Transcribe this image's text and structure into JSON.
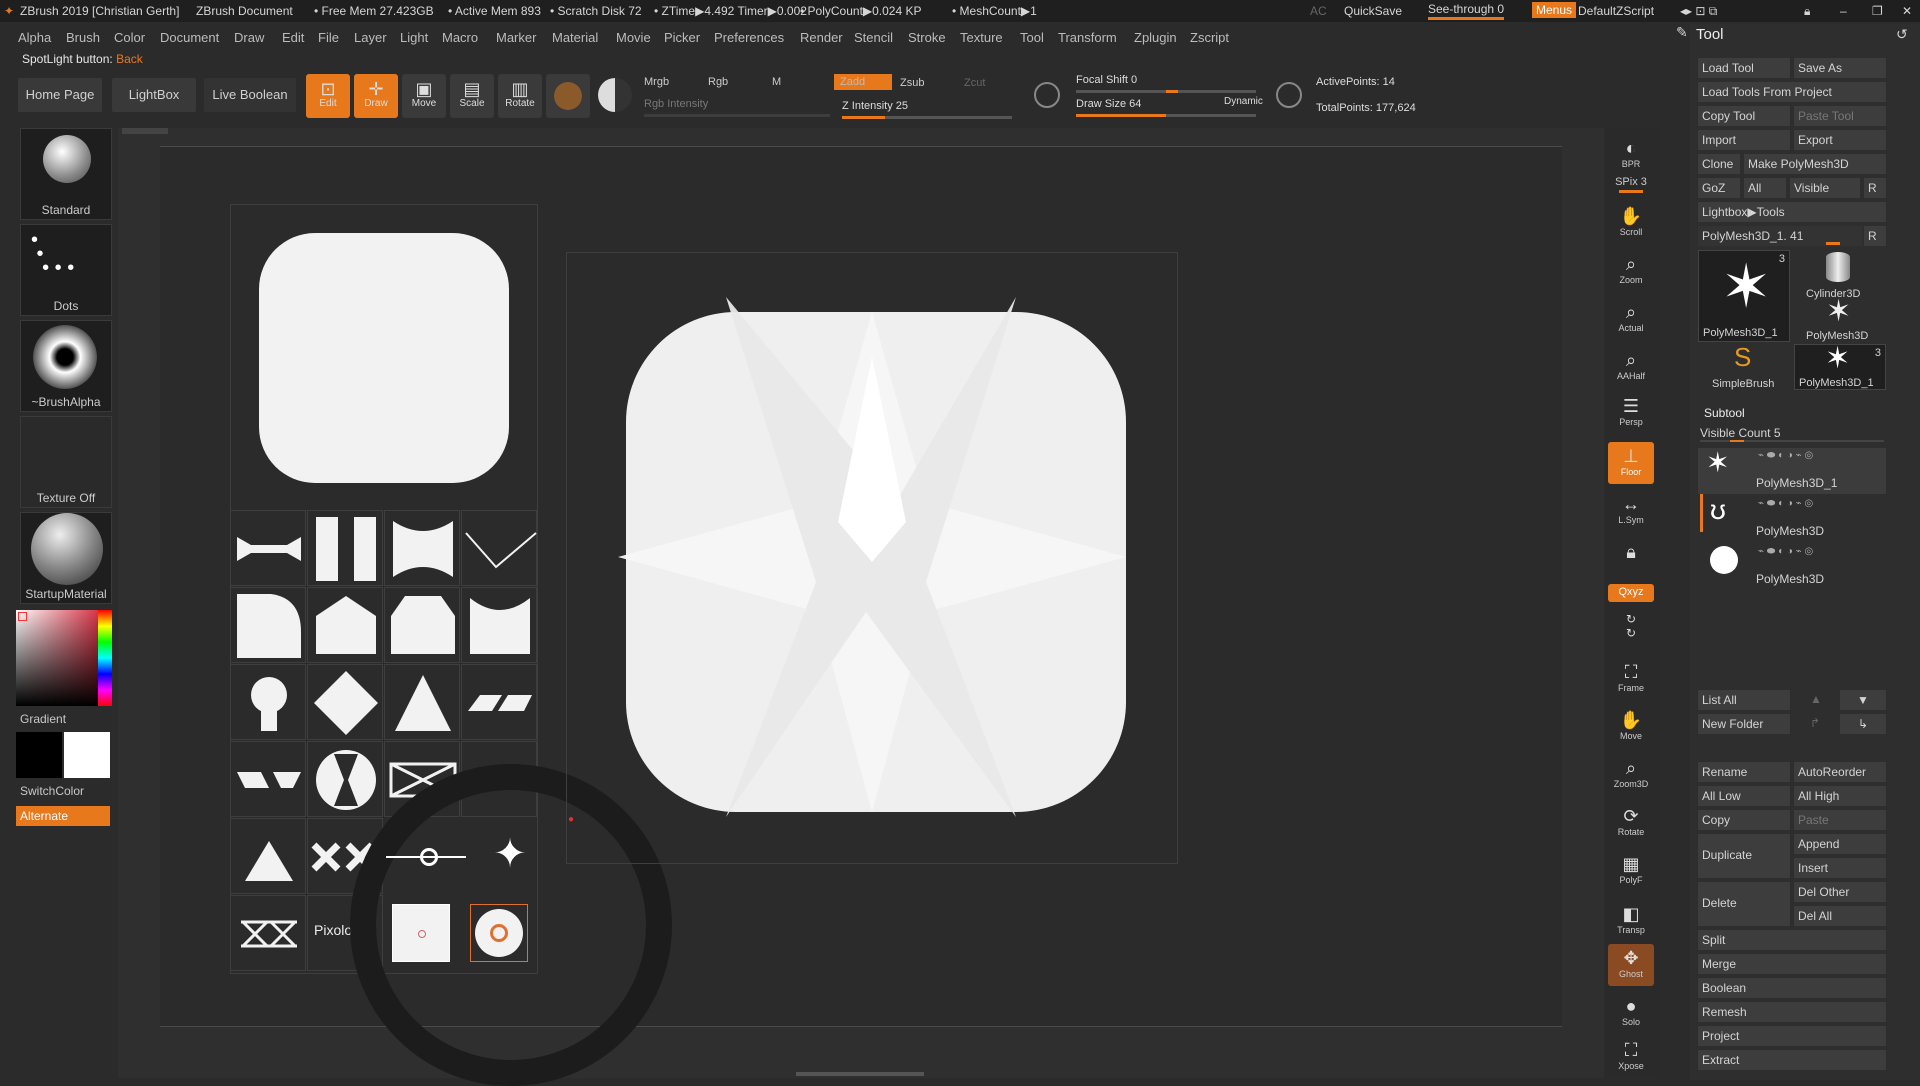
{
  "titlebar": {
    "app": "ZBrush 2019 [Christian Gerth]",
    "document": "ZBrush Document",
    "free_mem": "• Free Mem 27.423GB",
    "active_mem": "• Active Mem 893",
    "scratch": "• Scratch Disk 72",
    "ztime": "• ZTime▶4.492 Timer▶0.002",
    "polycount": "• PolyCount▶0.024 KP",
    "meshcount": "• MeshCount▶1",
    "ac": "AC",
    "quicksave": "QuickSave",
    "seethrough": "See-through  0",
    "menus": "Menus",
    "script": "DefaultZScript"
  },
  "menubar": [
    "Alpha",
    "Brush",
    "Color",
    "Document",
    "Draw",
    "Edit",
    "File",
    "Layer",
    "Light",
    "Macro",
    "Marker",
    "Material",
    "Movie",
    "Picker",
    "Preferences",
    "Render",
    "Stencil",
    "Stroke",
    "Texture",
    "Tool",
    "Transform",
    "Zplugin",
    "Zscript"
  ],
  "spotlight": {
    "label": "SpotLight button:",
    "value": "Back"
  },
  "shelf": {
    "home": "Home Page",
    "lightbox": "LightBox",
    "liveboolean": "Live Boolean",
    "tools": [
      {
        "label": "Edit",
        "icon": "edit-icon",
        "on": true
      },
      {
        "label": "Draw",
        "icon": "draw-icon",
        "on": true
      },
      {
        "label": "Move",
        "icon": "move-icon",
        "on": false
      },
      {
        "label": "Scale",
        "icon": "scale-icon",
        "on": false
      },
      {
        "label": "Rotate",
        "icon": "rotate-icon",
        "on": false
      }
    ],
    "mrgb": "Mrgb",
    "rgb": "Rgb",
    "m": "M",
    "rgb_intensity": "Rgb Intensity",
    "zadd": "Zadd",
    "zsub": "Zsub",
    "zcut": "Zcut",
    "z_intensity": "Z Intensity 25",
    "z_intensity_value": 25,
    "focal_shift": "Focal Shift 0",
    "draw_size": "Draw Size 64",
    "draw_size_value": 64,
    "dynamic": "Dynamic",
    "active_points": "ActivePoints: 14",
    "total_points": "TotalPoints: 177,624"
  },
  "left": {
    "brush": "Standard",
    "stroke": "Dots",
    "alpha": "~BrushAlpha",
    "texture": "Texture Off",
    "material": "StartupMaterial",
    "gradient": "Gradient",
    "switchcolor": "SwitchColor",
    "alternate": "Alternate"
  },
  "spotlight_panel": {
    "text_tile": "Pixologic"
  },
  "rightshelf": [
    {
      "label": "BPR",
      "icon": "bpr-icon"
    },
    {
      "label": "SPix 3",
      "icon": ""
    },
    {
      "label": "Scroll",
      "icon": "scroll-icon"
    },
    {
      "label": "Zoom",
      "icon": "zoom-icon"
    },
    {
      "label": "Actual",
      "icon": "actual-icon"
    },
    {
      "label": "AAHalf",
      "icon": "aahalf-icon"
    },
    {
      "label": "Persp",
      "icon": "persp-icon"
    },
    {
      "label": "Floor",
      "icon": "floor-icon"
    },
    {
      "label": "L.Sym",
      "icon": "lsym-icon"
    },
    {
      "label": "",
      "icon": "lock-icon"
    },
    {
      "label": "Qxyz",
      "icon": ""
    },
    {
      "label": "Frame",
      "icon": "frame-icon"
    },
    {
      "label": "Move",
      "icon": "move-icon"
    },
    {
      "label": "Zoom3D",
      "icon": "zoom3d-icon"
    },
    {
      "label": "Rotate",
      "icon": "rotate-icon"
    },
    {
      "label": "PolyF",
      "icon": "polyf-icon"
    },
    {
      "label": "Transp",
      "icon": "transp-icon"
    },
    {
      "label": "Ghost",
      "icon": "ghost-icon"
    },
    {
      "label": "Solo",
      "icon": "solo-icon"
    },
    {
      "label": "Xpose",
      "icon": "xpose-icon"
    }
  ],
  "tool": {
    "title": "Tool",
    "load_tool": "Load Tool",
    "save_as": "Save As",
    "load_from_project": "Load Tools From Project",
    "copy_tool": "Copy Tool",
    "paste_tool": "Paste Tool",
    "import": "Import",
    "export": "Export",
    "clone": "Clone",
    "make_polymesh": "Make PolyMesh3D",
    "goz": "GoZ",
    "all": "All",
    "visible": "Visible",
    "r": "R",
    "lightbox_tools": "Lightbox▶Tools",
    "current_tool": "PolyMesh3D_1. 41",
    "thumbs": [
      {
        "name": "PolyMesh3D_1",
        "badge": "3"
      },
      {
        "name": "Cylinder3D",
        "badge": ""
      },
      {
        "name": "PolyMesh3D",
        "badge": ""
      },
      {
        "name": "SimpleBrush",
        "badge": ""
      },
      {
        "name": "PolyMesh3D_1",
        "badge": "3"
      }
    ],
    "subtool_title": "Subtool",
    "visible_count": "Visible Count 5",
    "subtools": [
      "PolyMesh3D_1",
      "PolyMesh3D",
      "PolyMesh3D"
    ],
    "list_all": "List All",
    "new_folder": "New Folder",
    "rename": "Rename",
    "autoreorder": "AutoReorder",
    "all_low": "All Low",
    "all_high": "All High",
    "copy": "Copy",
    "paste": "Paste",
    "duplicate": "Duplicate",
    "append": "Append",
    "insert": "Insert",
    "delete": "Delete",
    "del_other": "Del Other",
    "del_all": "Del All",
    "split": "Split",
    "merge": "Merge",
    "boolean": "Boolean",
    "remesh": "Remesh",
    "project": "Project",
    "extract": "Extract"
  }
}
